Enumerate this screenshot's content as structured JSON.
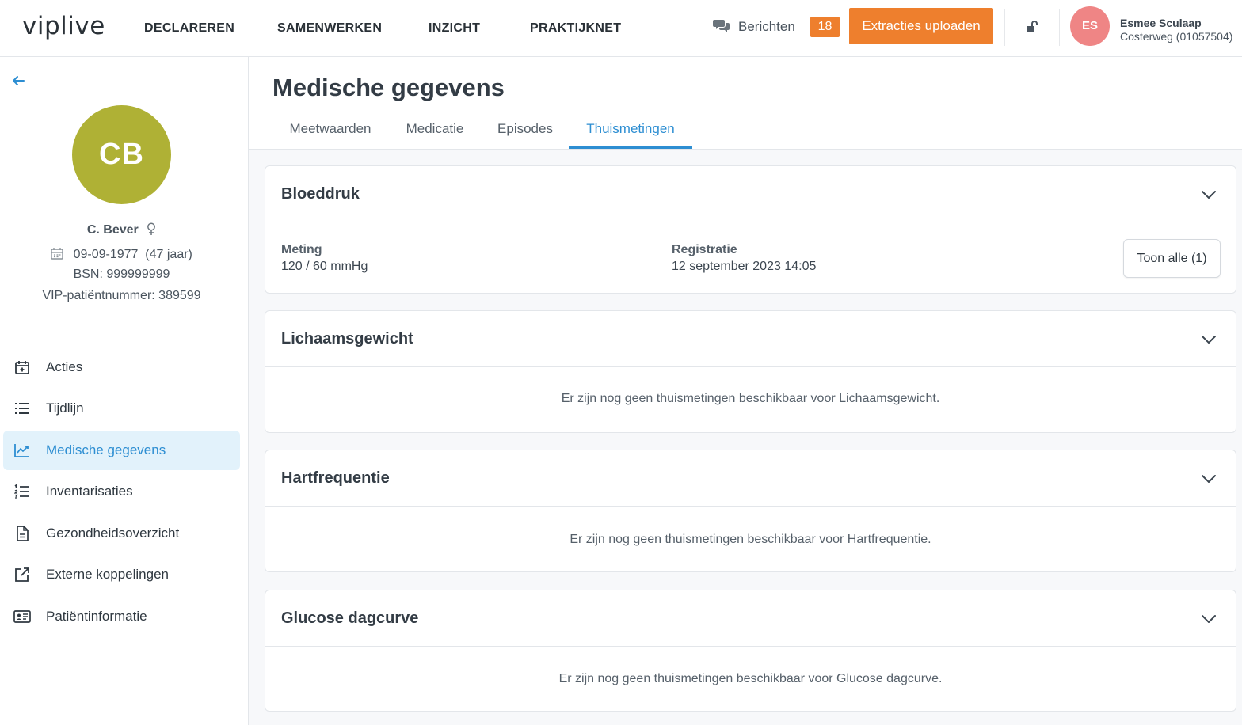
{
  "header": {
    "logo": "viplive",
    "nav": [
      "DECLAREREN",
      "SAMENWERKEN",
      "INZICHT",
      "PRAKTIJKNET"
    ],
    "messages_label": "Berichten",
    "messages_count": "18",
    "upload_label": "Extracties uploaden",
    "user_initials": "ES",
    "user_name": "Esmee Sculaap",
    "user_practice": "Costerweg (01057504)"
  },
  "patient": {
    "initials": "CB",
    "name": "C. Bever",
    "dob": "09-09-1977",
    "age": "(47 jaar)",
    "bsn": "BSN: 999999999",
    "vip": "VIP-patiëntnummer: 389599"
  },
  "sidebar": {
    "items": [
      {
        "label": "Acties",
        "icon": "calendar-plus-icon"
      },
      {
        "label": "Tijdlijn",
        "icon": "list-icon"
      },
      {
        "label": "Medische gegevens",
        "icon": "chart-line-icon"
      },
      {
        "label": "Inventarisaties",
        "icon": "numbered-list-icon"
      },
      {
        "label": "Gezondheidsoverzicht",
        "icon": "document-icon"
      },
      {
        "label": "Externe koppelingen",
        "icon": "external-link-icon"
      },
      {
        "label": "Patiëntinformatie",
        "icon": "id-card-icon"
      }
    ],
    "active_index": 2
  },
  "main": {
    "title": "Medische gegevens",
    "tabs": [
      "Meetwaarden",
      "Medicatie",
      "Episodes",
      "Thuismetingen"
    ],
    "active_tab": 3,
    "cards": [
      {
        "title": "Bloeddruk",
        "col1_label": "Meting",
        "col1_value": "120 / 60 mmHg",
        "col2_label": "Registratie",
        "col2_value": "12 september 2023 14:05",
        "button": "Toon alle (1)"
      },
      {
        "title": "Lichaamsgewicht",
        "empty": "Er zijn nog geen thuismetingen beschikbaar voor Lichaamsgewicht."
      },
      {
        "title": "Hartfrequentie",
        "empty": "Er zijn nog geen thuismetingen beschikbaar voor Hartfrequentie."
      },
      {
        "title": "Glucose dagcurve",
        "empty": "Er zijn nog geen thuismetingen beschikbaar voor Glucose dagcurve."
      }
    ]
  },
  "colors": {
    "accent": "#2d8ed2",
    "orange": "#ee7f2d",
    "patient_avatar": "#afb135",
    "user_avatar": "#ef8585"
  }
}
